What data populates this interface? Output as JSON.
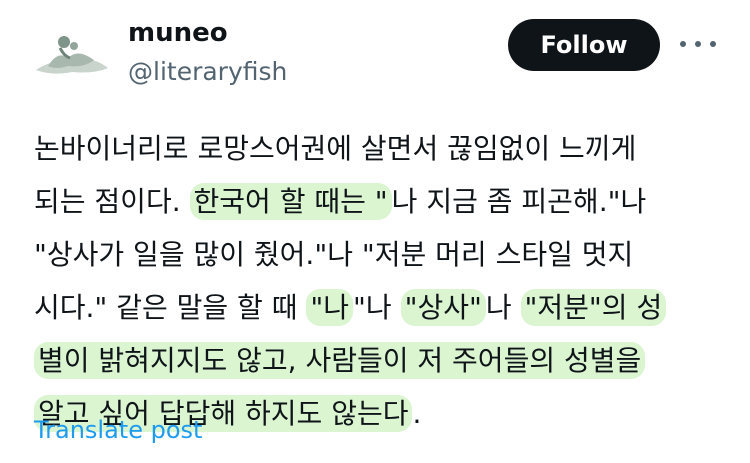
{
  "author": {
    "name": "muneo",
    "handle": "@literaryfish"
  },
  "actions": {
    "follow_label": "Follow",
    "more_icon": "more-icon"
  },
  "post": {
    "lines": [
      [
        {
          "text": "논바이너리로 로망스어권에 살면서 끊임없이 느끼게",
          "hl": false
        }
      ],
      [
        {
          "text": "되는 점이다. ",
          "hl": false
        },
        {
          "text": "한국어 할 때는 \"",
          "hl": true
        },
        {
          "text": "나 지금 좀 피곤해.\"나",
          "hl": false
        }
      ],
      [
        {
          "text": "\"상사가 일을 많이 줬어.\"나 \"저분 머리 스타일 멋지",
          "hl": false
        }
      ],
      [
        {
          "text": "시다.\" 같은 말을 할 때 ",
          "hl": false
        },
        {
          "text": "\"나",
          "hl": true
        },
        {
          "text": "\"나 ",
          "hl": false
        },
        {
          "text": "\"상사\"",
          "hl": true
        },
        {
          "text": "나 ",
          "hl": false
        },
        {
          "text": "\"저분\"의 성",
          "hl": true
        }
      ],
      [
        {
          "text": "별이 밝혀지지도 않고, 사람들이 저 주어들의 성별을",
          "hl": true
        }
      ],
      [
        {
          "text": "알고 싶어 답답해 하지도 않는다",
          "hl": true
        },
        {
          "text": ".",
          "hl": false
        }
      ]
    ]
  },
  "footer": {
    "translate_label": "Translate post"
  },
  "colors": {
    "highlight": "#ade896",
    "link": "#1d9bf0",
    "follow_bg": "#0f1419"
  }
}
